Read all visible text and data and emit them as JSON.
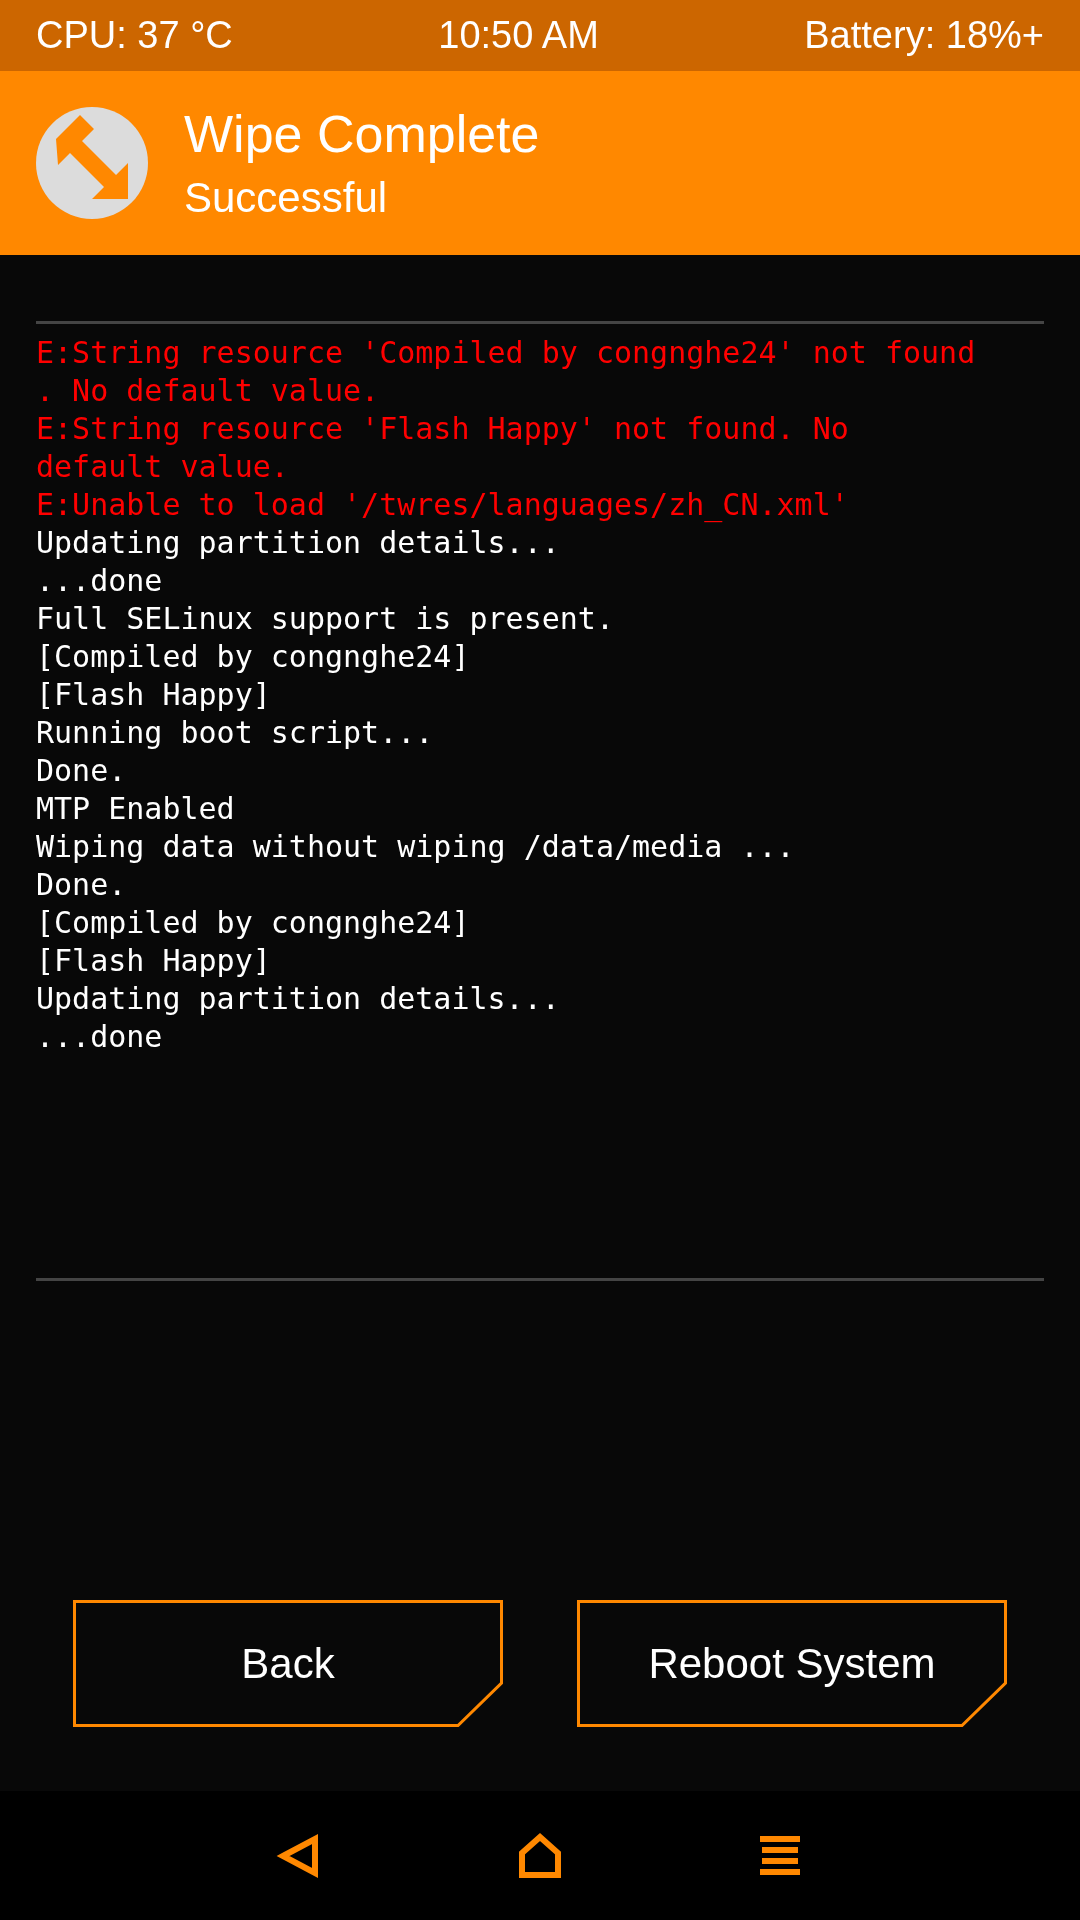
{
  "status_bar": {
    "cpu": "CPU: 37 °C",
    "time": "10:50 AM",
    "battery": "Battery: 18%+"
  },
  "header": {
    "title": "Wipe Complete",
    "subtitle": "Successful"
  },
  "console": [
    {
      "kind": "error",
      "text": "E:String resource 'Compiled by congnghe24' not found"
    },
    {
      "kind": "error",
      "text": ". No default value."
    },
    {
      "kind": "error",
      "text": "E:String resource 'Flash Happy' not found. No"
    },
    {
      "kind": "error",
      "text": "default value."
    },
    {
      "kind": "error",
      "text": "E:Unable to load '/twres/languages/zh_CN.xml'"
    },
    {
      "kind": "info",
      "text": "Updating partition details..."
    },
    {
      "kind": "info",
      "text": "...done"
    },
    {
      "kind": "info",
      "text": "Full SELinux support is present."
    },
    {
      "kind": "info",
      "text": "[Compiled by congnghe24]"
    },
    {
      "kind": "info",
      "text": "[Flash Happy]"
    },
    {
      "kind": "info",
      "text": "Running boot script..."
    },
    {
      "kind": "info",
      "text": "Done."
    },
    {
      "kind": "info",
      "text": "MTP Enabled"
    },
    {
      "kind": "info",
      "text": "Wiping data without wiping /data/media ..."
    },
    {
      "kind": "info",
      "text": "Done."
    },
    {
      "kind": "info",
      "text": "[Compiled by congnghe24]"
    },
    {
      "kind": "info",
      "text": "[Flash Happy]"
    },
    {
      "kind": "info",
      "text": "Updating partition details..."
    },
    {
      "kind": "info",
      "text": "...done"
    }
  ],
  "buttons": [
    "Back",
    "Reboot System"
  ]
}
